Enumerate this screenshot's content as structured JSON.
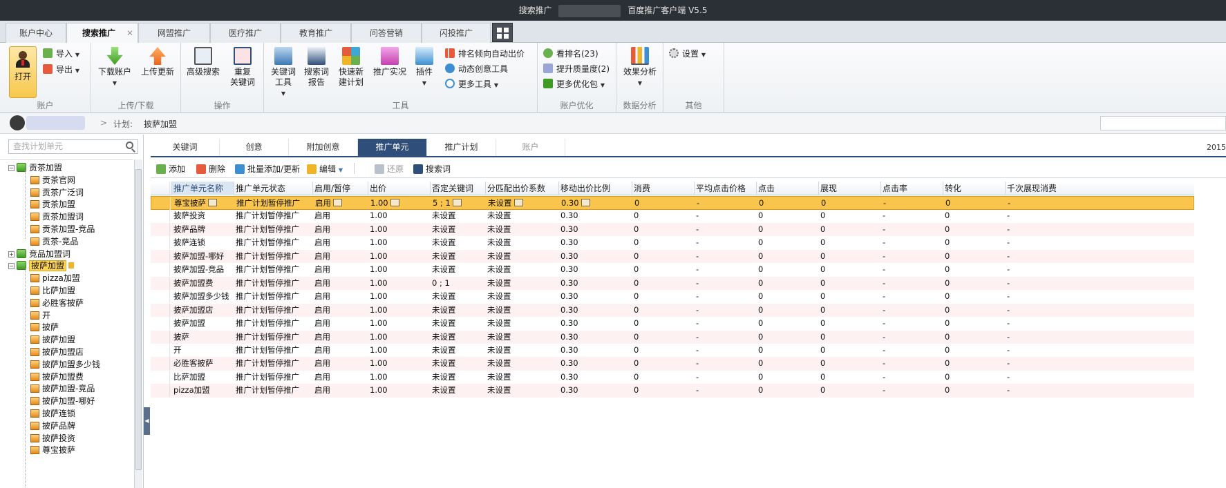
{
  "window": {
    "title_left": "搜索推广",
    "title_right": "百度推广客户端 V5.5"
  },
  "main_tabs": [
    {
      "label": "账户中心"
    },
    {
      "label": "搜索推广"
    },
    {
      "label": "网盟推广"
    },
    {
      "label": "医疗推广"
    },
    {
      "label": "教育推广"
    },
    {
      "label": "问答营销"
    },
    {
      "label": "闪投推广"
    }
  ],
  "ribbon": {
    "account": {
      "open": "打开",
      "import": "导入",
      "export": "导出",
      "group": "账户"
    },
    "updown": {
      "download": "下载账户",
      "upload": "上传更新",
      "group": "上传/下载"
    },
    "ops": {
      "adv_search": "高级搜索",
      "dup_kw_1": "重复",
      "dup_kw_2": "关键词",
      "group": "操作"
    },
    "tools": {
      "kw_tool_1": "关键词",
      "kw_tool_2": "工具",
      "sq_report_1": "搜索词",
      "sq_report_2": "报告",
      "quick_plan_1": "快速新",
      "quick_plan_2": "建计划",
      "live_view": "推广实况",
      "plugins": "插件",
      "rank_bid": "排名倾向自动出价",
      "dynamic_creative": "动态创意工具",
      "more_tools": "更多工具",
      "group": "工具"
    },
    "optimize": {
      "view_rank": "看排名(23)",
      "quality": "提升质量度(2)",
      "more_pkg": "更多优化包",
      "group": "账户优化"
    },
    "analysis": {
      "effect_1": "效果分析",
      "group": "数据分析"
    },
    "other": {
      "settings": "设置",
      "group": "其他"
    }
  },
  "breadcrumb": {
    "sep": ">",
    "plan_label": "计划:",
    "plan_name": "披萨加盟"
  },
  "tree": {
    "search_placeholder": "查找计划单元",
    "nodes": [
      {
        "label": "贡茶加盟",
        "type": "plan",
        "expanded": true
      },
      {
        "label": "贡茶官网",
        "type": "unit"
      },
      {
        "label": "贡茶广泛词",
        "type": "unit"
      },
      {
        "label": "贡茶加盟",
        "type": "unit"
      },
      {
        "label": "贡茶加盟词",
        "type": "unit"
      },
      {
        "label": "贡茶加盟-竞品",
        "type": "unit"
      },
      {
        "label": "贡茶-竞品",
        "type": "unit"
      },
      {
        "label": "竞品加盟词",
        "type": "plan",
        "expanded": false
      },
      {
        "label": "披萨加盟",
        "type": "plan",
        "expanded": true,
        "selected": true
      },
      {
        "label": "pizza加盟",
        "type": "unit"
      },
      {
        "label": "比萨加盟",
        "type": "unit"
      },
      {
        "label": "必胜客披萨",
        "type": "unit"
      },
      {
        "label": "开",
        "type": "unit"
      },
      {
        "label": "披萨",
        "type": "unit"
      },
      {
        "label": "披萨加盟",
        "type": "unit"
      },
      {
        "label": "披萨加盟店",
        "type": "unit"
      },
      {
        "label": "披萨加盟多少钱",
        "type": "unit"
      },
      {
        "label": "披萨加盟费",
        "type": "unit"
      },
      {
        "label": "披萨加盟-竞品",
        "type": "unit"
      },
      {
        "label": "披萨加盟-哪好",
        "type": "unit"
      },
      {
        "label": "披萨连锁",
        "type": "unit"
      },
      {
        "label": "披萨品牌",
        "type": "unit"
      },
      {
        "label": "披萨投资",
        "type": "unit"
      },
      {
        "label": "尊宝披萨",
        "type": "unit"
      }
    ]
  },
  "content_tabs": [
    {
      "label": "关键词"
    },
    {
      "label": "创意"
    },
    {
      "label": "附加创意"
    },
    {
      "label": "推广单元",
      "active": true
    },
    {
      "label": "推广计划"
    },
    {
      "label": "账户",
      "disabled": true
    }
  ],
  "date_fragment": "2015",
  "toolbar": {
    "add": "添加",
    "delete": "删除",
    "batch": "批量添加/更新",
    "edit": "编辑",
    "restore": "还原",
    "search_terms": "搜索词"
  },
  "table": {
    "columns": [
      "推广单元名称",
      "推广单元状态",
      "启用/暂停",
      "出价",
      "否定关键词",
      "分匹配出价系数",
      "移动出价比例",
      "消费",
      "平均点击价格",
      "点击",
      "展现",
      "点击率",
      "转化",
      "千次展现消费"
    ],
    "rows": [
      [
        "尊宝披萨",
        "推广计划暂停推广",
        "启用",
        "1.00",
        "5 ; 1",
        "未设置",
        "0.30",
        "0",
        "-",
        "0",
        "0",
        "-",
        "0",
        "-"
      ],
      [
        "披萨投资",
        "推广计划暂停推广",
        "启用",
        "1.00",
        "未设置",
        "未设置",
        "0.30",
        "0",
        "-",
        "0",
        "0",
        "-",
        "0",
        "-"
      ],
      [
        "披萨品牌",
        "推广计划暂停推广",
        "启用",
        "1.00",
        "未设置",
        "未设置",
        "0.30",
        "0",
        "-",
        "0",
        "0",
        "-",
        "0",
        "-"
      ],
      [
        "披萨连锁",
        "推广计划暂停推广",
        "启用",
        "1.00",
        "未设置",
        "未设置",
        "0.30",
        "0",
        "-",
        "0",
        "0",
        "-",
        "0",
        "-"
      ],
      [
        "披萨加盟-哪好",
        "推广计划暂停推广",
        "启用",
        "1.00",
        "未设置",
        "未设置",
        "0.30",
        "0",
        "-",
        "0",
        "0",
        "-",
        "0",
        "-"
      ],
      [
        "披萨加盟-竞品",
        "推广计划暂停推广",
        "启用",
        "1.00",
        "未设置",
        "未设置",
        "0.30",
        "0",
        "-",
        "0",
        "0",
        "-",
        "0",
        "-"
      ],
      [
        "披萨加盟费",
        "推广计划暂停推广",
        "启用",
        "1.00",
        "0 ; 1",
        "未设置",
        "0.30",
        "0",
        "-",
        "0",
        "0",
        "-",
        "0",
        "-"
      ],
      [
        "披萨加盟多少钱",
        "推广计划暂停推广",
        "启用",
        "1.00",
        "未设置",
        "未设置",
        "0.30",
        "0",
        "-",
        "0",
        "0",
        "-",
        "0",
        "-"
      ],
      [
        "披萨加盟店",
        "推广计划暂停推广",
        "启用",
        "1.00",
        "未设置",
        "未设置",
        "0.30",
        "0",
        "-",
        "0",
        "0",
        "-",
        "0",
        "-"
      ],
      [
        "披萨加盟",
        "推广计划暂停推广",
        "启用",
        "1.00",
        "未设置",
        "未设置",
        "0.30",
        "0",
        "-",
        "0",
        "0",
        "-",
        "0",
        "-"
      ],
      [
        "披萨",
        "推广计划暂停推广",
        "启用",
        "1.00",
        "未设置",
        "未设置",
        "0.30",
        "0",
        "-",
        "0",
        "0",
        "-",
        "0",
        "-"
      ],
      [
        "开",
        "推广计划暂停推广",
        "启用",
        "1.00",
        "未设置",
        "未设置",
        "0.30",
        "0",
        "-",
        "0",
        "0",
        "-",
        "0",
        "-"
      ],
      [
        "必胜客披萨",
        "推广计划暂停推广",
        "启用",
        "1.00",
        "未设置",
        "未设置",
        "0.30",
        "0",
        "-",
        "0",
        "0",
        "-",
        "0",
        "-"
      ],
      [
        "比萨加盟",
        "推广计划暂停推广",
        "启用",
        "1.00",
        "未设置",
        "未设置",
        "0.30",
        "0",
        "-",
        "0",
        "0",
        "-",
        "0",
        "-"
      ],
      [
        "pizza加盟",
        "推广计划暂停推广",
        "启用",
        "1.00",
        "未设置",
        "未设置",
        "0.30",
        "0",
        "-",
        "0",
        "0",
        "-",
        "0",
        "-"
      ]
    ]
  },
  "colors": {
    "accent": "#2f4f7a",
    "selected_row": "#f9c54c",
    "alt_row": "#fdf1f1"
  }
}
